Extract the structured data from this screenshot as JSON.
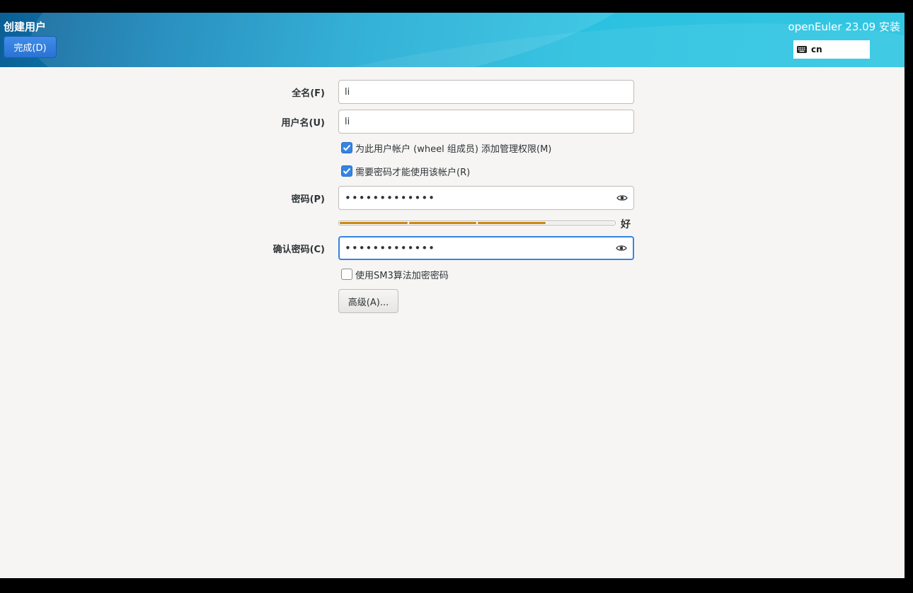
{
  "header": {
    "title": "创建用户",
    "done_label": "完成(D)",
    "product": "openEuler 23.09 安装",
    "keyboard_layout": "cn",
    "keyboard_icon": "keyboard-icon"
  },
  "form": {
    "fullname": {
      "label": "全名(F)",
      "value": "li"
    },
    "username": {
      "label": "用户名(U)",
      "value": "li"
    },
    "admin_checkbox": {
      "label": "为此用户帐户 (wheel 组成员) 添加管理权限(M)",
      "checked": true
    },
    "require_password_checkbox": {
      "label": "需要密码才能使用该帐户(R)",
      "checked": true
    },
    "password": {
      "label": "密码(P)",
      "masked": "•••••••••••••",
      "reveal_icon": "eye-icon"
    },
    "strength": {
      "level": 0.75,
      "segments_filled": 3,
      "segments_total": 4,
      "text": "好",
      "color": "#c98612"
    },
    "confirm": {
      "label": "确认密码(C)",
      "masked": "•••••••••••••",
      "reveal_icon": "eye-icon"
    },
    "sm3_checkbox": {
      "label": "使用SM3算法加密密码",
      "checked": false
    },
    "advanced_label": "高级(A)..."
  },
  "colors": {
    "accent": "#3584e4",
    "strength_bar": "#c98612"
  }
}
